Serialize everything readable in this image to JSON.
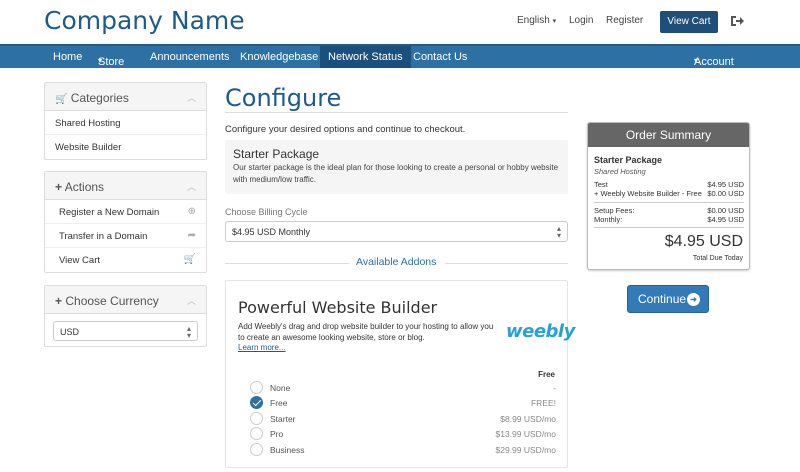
{
  "header": {
    "brand": "Company Name",
    "language": "English",
    "login": "Login",
    "register": "Register",
    "view_cart": "View Cart"
  },
  "nav": {
    "items": [
      "Home",
      "Store",
      "Announcements",
      "Knowledgebase",
      "Network Status",
      "Contact Us"
    ],
    "account": "Account"
  },
  "sidebar": {
    "categories": {
      "title": "Categories",
      "items": [
        "Shared Hosting",
        "Website Builder"
      ]
    },
    "actions": {
      "title": "Actions",
      "items": [
        "Register a New Domain",
        "Transfer in a Domain",
        "View Cart"
      ]
    },
    "currency": {
      "title": "Choose Currency",
      "value": "USD"
    }
  },
  "main": {
    "title": "Configure",
    "intro": "Configure your desired options and continue to checkout.",
    "package": {
      "name": "Starter Package",
      "description": "Our starter package is the ideal plan for those looking to create a personal or hobby website with medium/low traffic."
    },
    "billing_label": "Choose Billing Cycle",
    "billing_value": "$4.95 USD Monthly",
    "addons_heading": "Available Addons",
    "addon": {
      "title": "Powerful Website Builder",
      "description": "Add Weebly's drag and drop website builder to your hosting to allow you to create an awesome looking website, store or blog.",
      "learn_more": "Learn more...",
      "logo": "weebly",
      "column_header": "Free",
      "options": [
        {
          "name": "None",
          "price": "-",
          "selected": false
        },
        {
          "name": "Free",
          "price": "FREE!",
          "selected": true
        },
        {
          "name": "Starter",
          "price": "$8.99 USD/mo",
          "selected": false
        },
        {
          "name": "Pro",
          "price": "$13.99 USD/mo",
          "selected": false
        },
        {
          "name": "Business",
          "price": "$29.99 USD/mo",
          "selected": false
        }
      ]
    }
  },
  "summary": {
    "title": "Order Summary",
    "package": "Starter Package",
    "group": "Shared Hosting",
    "lines": [
      {
        "label": "Test",
        "value": "$4.95 USD"
      },
      {
        "label": "+ Weebly Website Builder - Free",
        "value": "$0.00 USD"
      }
    ],
    "fees": [
      {
        "label": "Setup Fees:",
        "value": "$0.00 USD"
      },
      {
        "label": "Monthly:",
        "value": "$4.95 USD"
      }
    ],
    "total": "$4.95 USD",
    "total_label": "Total Due Today"
  },
  "continue_label": "Continue",
  "colors": {
    "brand": "#1d5a8e",
    "nav": "#2d70a4",
    "button": "#337ab7",
    "summary_header": "#666666"
  }
}
